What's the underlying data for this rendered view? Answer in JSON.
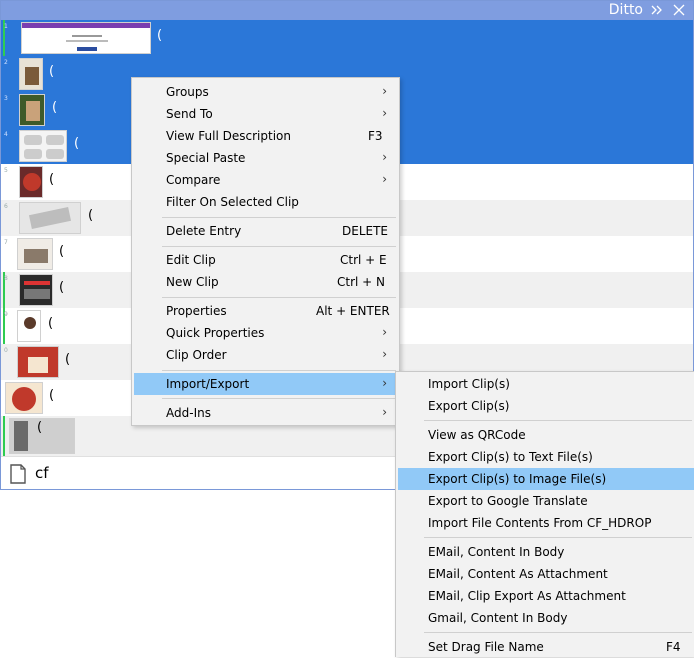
{
  "window": {
    "title": "Ditto"
  },
  "clips": [
    {
      "num": "1",
      "text": "(",
      "state": "selected",
      "mark": true
    },
    {
      "num": "2",
      "text": "(",
      "state": "selected",
      "mark": false
    },
    {
      "num": "3",
      "text": "(",
      "state": "selected",
      "mark": false
    },
    {
      "num": "4",
      "text": "(",
      "state": "selected",
      "mark": false
    },
    {
      "num": "5",
      "text": "(",
      "state": "plain",
      "mark": false
    },
    {
      "num": "6",
      "text": "(",
      "state": "alt",
      "mark": false
    },
    {
      "num": "7",
      "text": "(",
      "state": "plain",
      "mark": false
    },
    {
      "num": "8",
      "text": "(",
      "state": "alt",
      "mark": true
    },
    {
      "num": "9",
      "text": "(",
      "state": "plain",
      "mark": true
    },
    {
      "num": "0",
      "text": "(",
      "state": "alt",
      "mark": false
    },
    {
      "num": "",
      "text": "(",
      "state": "plain",
      "mark": false
    },
    {
      "num": "",
      "text": "(",
      "state": "alt",
      "mark": true
    }
  ],
  "search": {
    "value": "cf"
  },
  "context_menu": {
    "groups": "Groups",
    "send_to": "Send To",
    "view_full": "View Full Description",
    "view_full_sc": "F3",
    "special_paste": "Special Paste",
    "compare": "Compare",
    "filter": "Filter On Selected Clip",
    "delete": "Delete Entry",
    "delete_sc": "DELETE",
    "edit": "Edit Clip",
    "edit_sc": "Ctrl + E",
    "new": "New Clip",
    "new_sc": "Ctrl + N",
    "properties": "Properties",
    "properties_sc": "Alt + ENTER",
    "quick_props": "Quick Properties",
    "clip_order": "Clip Order",
    "import_export": "Import/Export",
    "addins": "Add-Ins"
  },
  "submenu": {
    "import_clips": "Import Clip(s)",
    "export_clips": "Export Clip(s)",
    "view_qr": "View as QRCode",
    "export_text": "Export Clip(s) to Text File(s)",
    "export_image": "Export Clip(s) to Image File(s)",
    "export_google": "Export to Google Translate",
    "import_cfhdrop": "Import File Contents From CF_HDROP",
    "email_body": "EMail, Content In Body",
    "email_attach": "EMail, Content As Attachment",
    "email_clip_export": "EMail, Clip Export As Attachment",
    "gmail_body": "Gmail, Content In Body",
    "set_drag": "Set Drag File Name",
    "set_drag_sc": "F4"
  }
}
